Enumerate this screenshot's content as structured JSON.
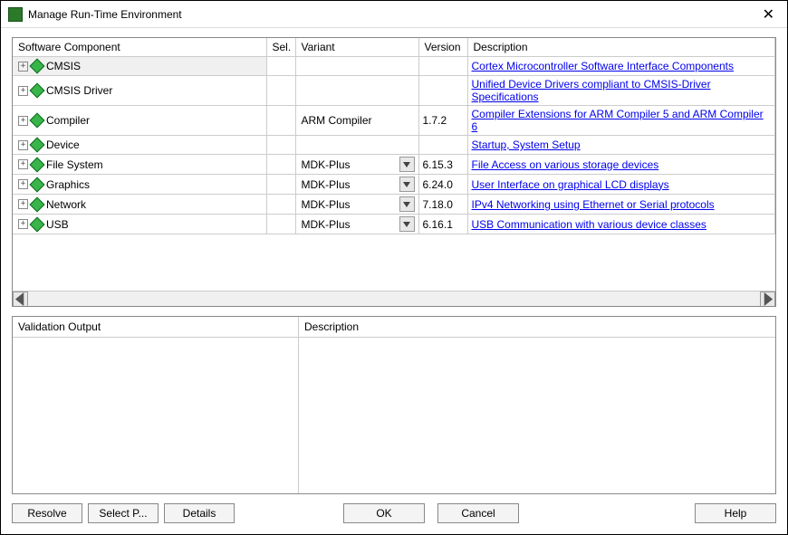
{
  "window": {
    "title": "Manage Run-Time Environment"
  },
  "columns": {
    "component": "Software Component",
    "sel": "Sel.",
    "variant": "Variant",
    "version": "Version",
    "description": "Description"
  },
  "rows": [
    {
      "name": "CMSIS",
      "variant": "",
      "has_dd": false,
      "version": "",
      "desc": "Cortex Microcontroller Software Interface Components",
      "link": true,
      "selected": true
    },
    {
      "name": "CMSIS Driver",
      "variant": "",
      "has_dd": false,
      "version": "",
      "desc": "Unified Device Drivers compliant to CMSIS-Driver Specifications",
      "link": true
    },
    {
      "name": "Compiler",
      "variant": "ARM Compiler",
      "has_dd": false,
      "version": "1.7.2",
      "desc": "Compiler Extensions for ARM Compiler 5 and ARM Compiler 6",
      "link": true
    },
    {
      "name": "Device",
      "variant": "",
      "has_dd": false,
      "version": "",
      "desc": "Startup, System Setup",
      "link": true
    },
    {
      "name": "File System",
      "variant": "MDK-Plus",
      "has_dd": true,
      "version": "6.15.3",
      "desc": "File Access on various storage devices",
      "link": true
    },
    {
      "name": "Graphics",
      "variant": "MDK-Plus",
      "has_dd": true,
      "version": "6.24.0",
      "desc": "User Interface on graphical LCD displays",
      "link": true
    },
    {
      "name": "Network",
      "variant": "MDK-Plus",
      "has_dd": true,
      "version": "7.18.0",
      "desc": "IPv4 Networking using Ethernet or Serial protocols",
      "link": true
    },
    {
      "name": "USB",
      "variant": "MDK-Plus",
      "has_dd": true,
      "version": "6.16.1",
      "desc": "USB Communication with various device classes",
      "link": true
    }
  ],
  "lower": {
    "validation_header": "Validation Output",
    "description_header": "Description"
  },
  "buttons": {
    "resolve": "Resolve",
    "select_packs": "Select P...",
    "details": "Details",
    "ok": "OK",
    "cancel": "Cancel",
    "help": "Help"
  }
}
